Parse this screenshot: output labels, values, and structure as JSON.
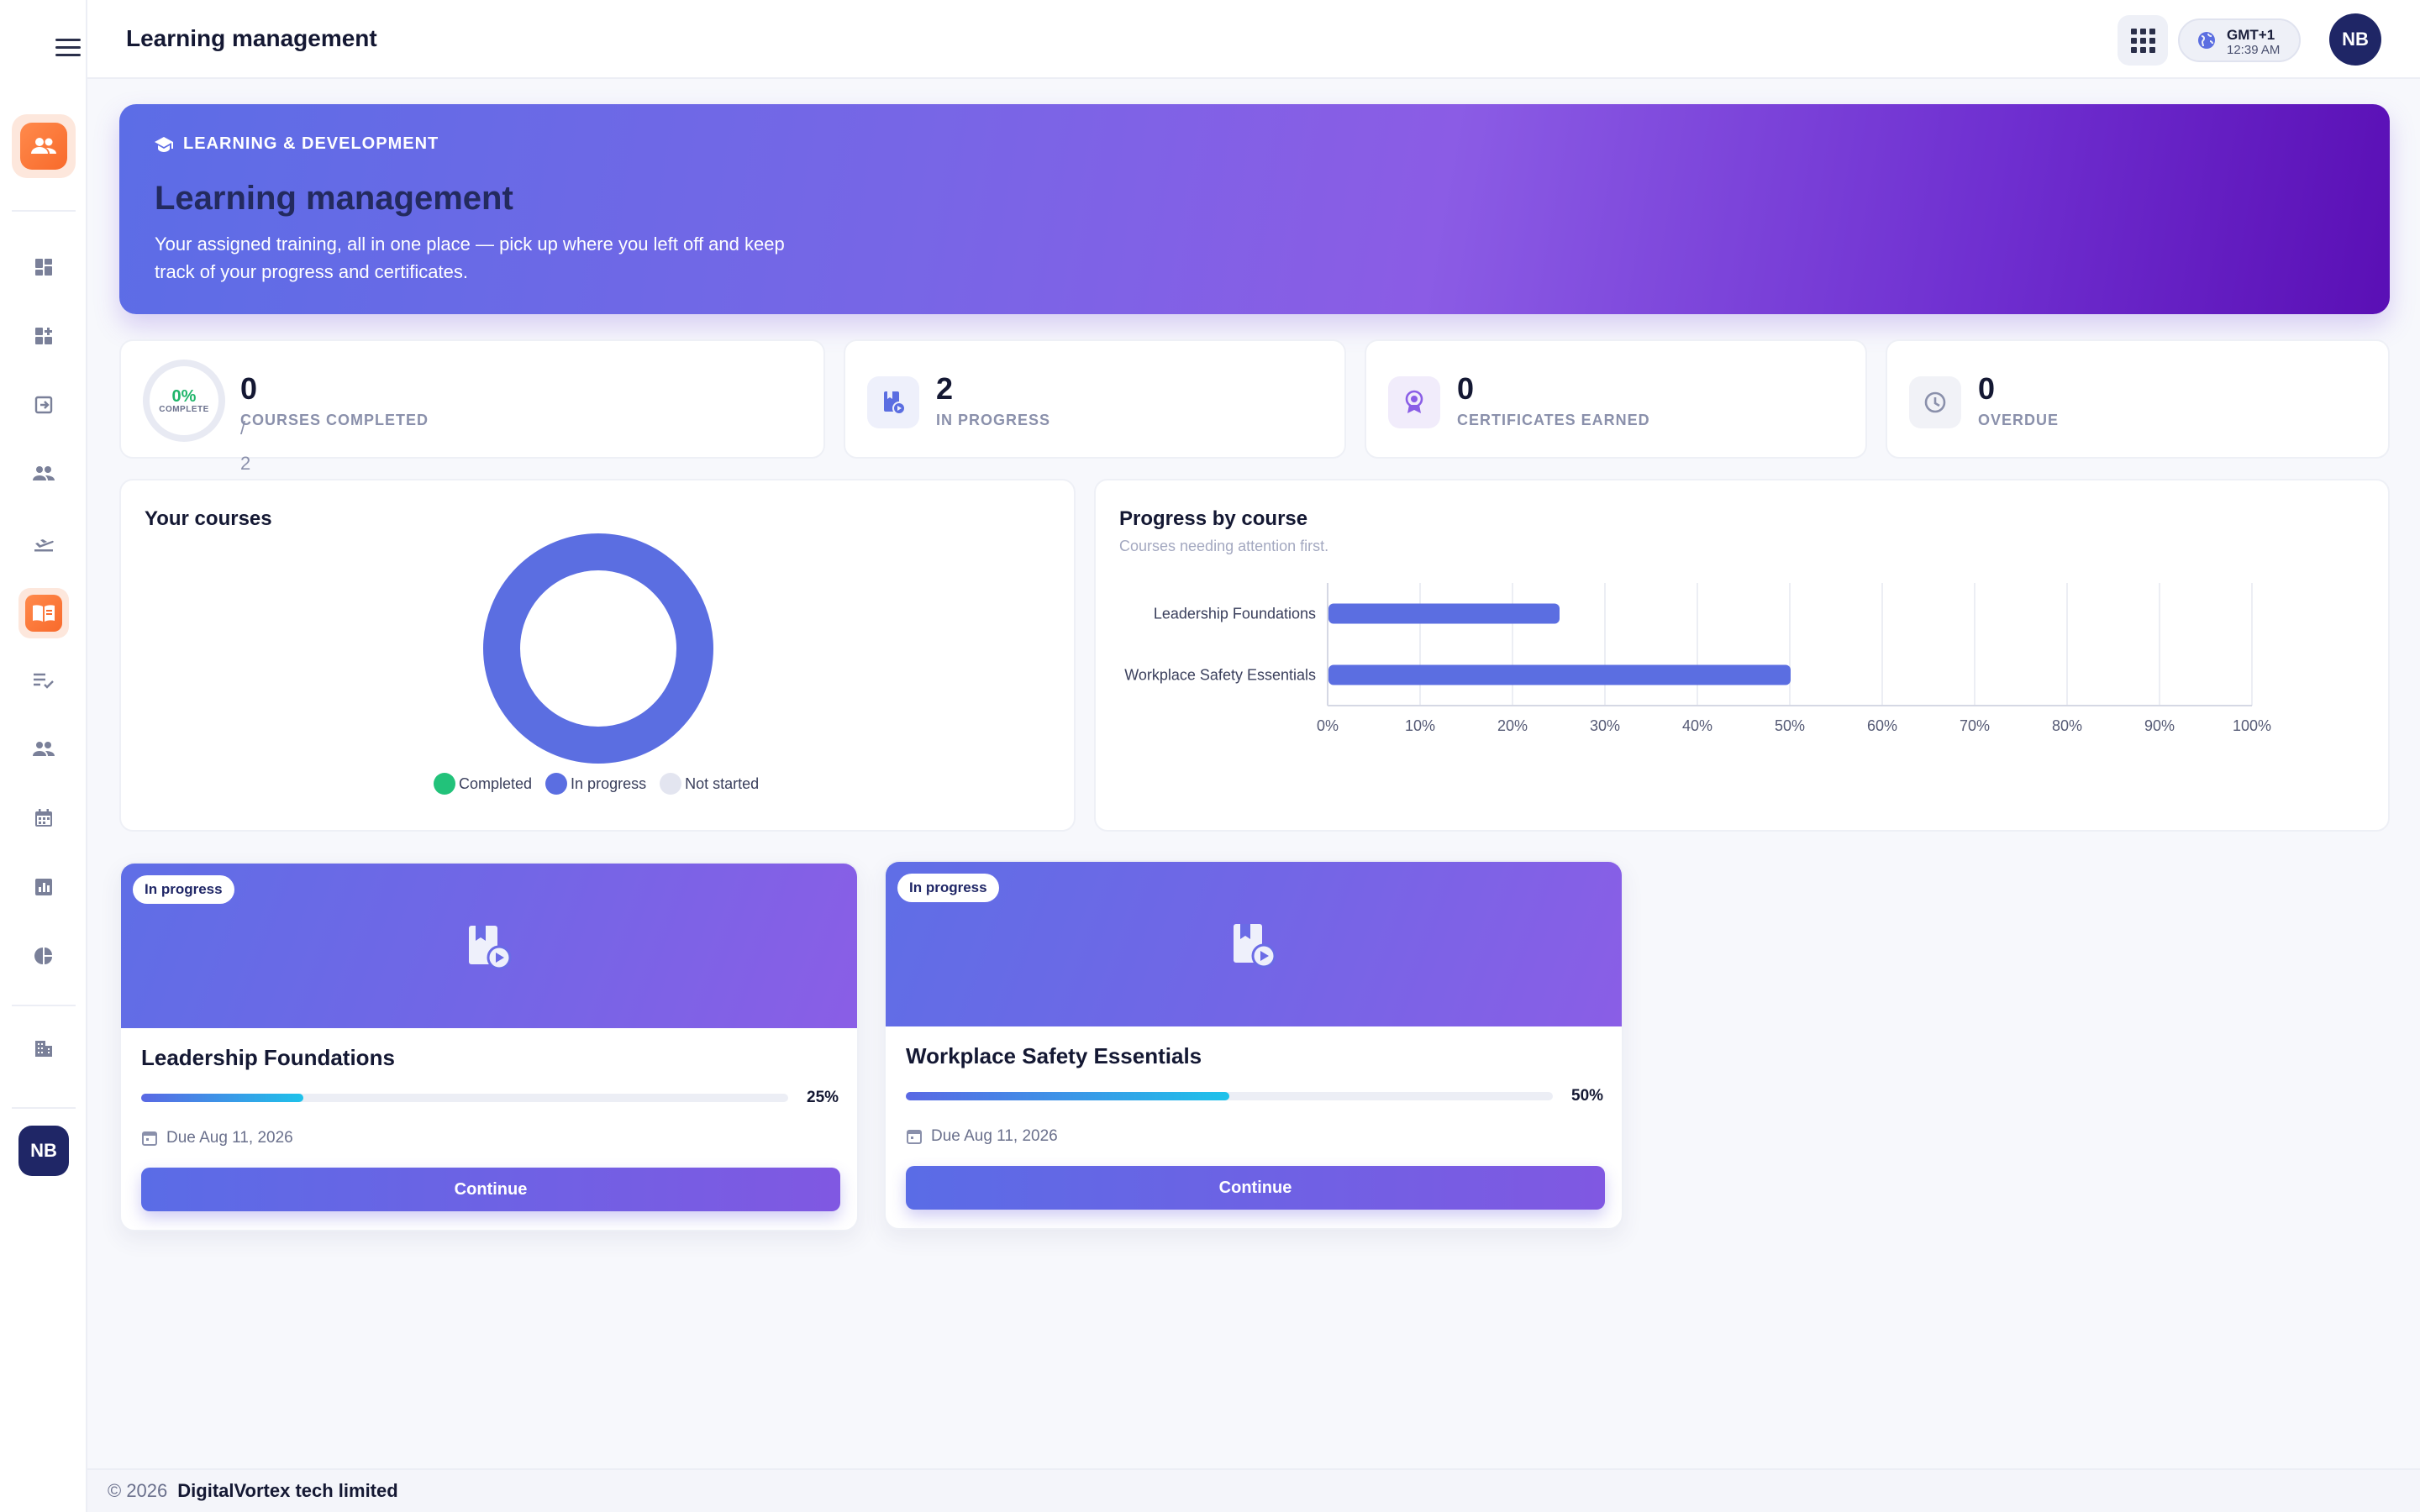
{
  "header": {
    "title": "Learning management",
    "timezone": {
      "zone": "GMT+1",
      "time": "12:39 AM"
    },
    "avatar_initials": "NB"
  },
  "sidebar": {
    "items": [
      {
        "icon": "dashboard-icon"
      },
      {
        "icon": "add-widget-icon"
      },
      {
        "icon": "sign-in-icon"
      },
      {
        "icon": "people-icon"
      },
      {
        "icon": "flight-takeoff-icon"
      },
      {
        "icon": "book-icon",
        "active": true
      },
      {
        "icon": "checklist-icon"
      },
      {
        "icon": "team-icon"
      },
      {
        "icon": "calendar-icon"
      },
      {
        "icon": "bar-chart-icon"
      },
      {
        "icon": "pie-chart-icon"
      },
      {
        "icon": "building-icon"
      }
    ],
    "avatar_initials": "NB"
  },
  "hero": {
    "eyebrow": "LEARNING & DEVELOPMENT",
    "title": "Learning management",
    "description": "Your assigned training, all in one place — pick up where you left off and keep track of your progress and certificates."
  },
  "stats": {
    "completed": {
      "percent": "0%",
      "ring_label": "COMPLETE",
      "value": "0",
      "total": "/ 2",
      "label": "COURSES COMPLETED"
    },
    "in_progress": {
      "value": "2",
      "label": "IN PROGRESS"
    },
    "certificates": {
      "value": "0",
      "label": "CERTIFICATES EARNED"
    },
    "overdue": {
      "value": "0",
      "label": "OVERDUE"
    }
  },
  "courses_panel": {
    "title": "Your courses",
    "legend": [
      "Completed",
      "In progress",
      "Not started"
    ]
  },
  "progress_panel": {
    "title": "Progress by course",
    "subtitle": "Courses needing attention first."
  },
  "chart_data": [
    {
      "type": "pie",
      "categories": [
        "Completed",
        "In progress",
        "Not started"
      ],
      "values": [
        0,
        2,
        0
      ],
      "colors": [
        "#22c27a",
        "#5b6ee1",
        "#e3e5f0"
      ],
      "donut": true
    },
    {
      "type": "bar",
      "orientation": "horizontal",
      "categories": [
        "Leadership Foundations",
        "Workplace Safety Essentials"
      ],
      "values": [
        25,
        50
      ],
      "xlim": [
        0,
        100
      ],
      "x_ticks": [
        "0%",
        "10%",
        "20%",
        "30%",
        "40%",
        "50%",
        "60%",
        "70%",
        "80%",
        "90%",
        "100%"
      ],
      "grid": true,
      "color": "#5b6ee1"
    }
  ],
  "course_cards": [
    {
      "status": "In progress",
      "name": "Leadership Foundations",
      "progress": 25,
      "progress_label": "25%",
      "due": "Due Aug 11, 2026",
      "button": "Continue"
    },
    {
      "status": "In progress",
      "name": "Workplace Safety Essentials",
      "progress": 50,
      "progress_label": "50%",
      "due": "Due Aug 11, 2026",
      "button": "Continue"
    }
  ],
  "footer": {
    "copyright": "© 2026",
    "company": "DigitalVortex tech limited"
  },
  "colors": {
    "accent": "#5b6ee1",
    "orange": "#f86a2b",
    "success": "#22c27a",
    "navy": "#1f2666"
  }
}
